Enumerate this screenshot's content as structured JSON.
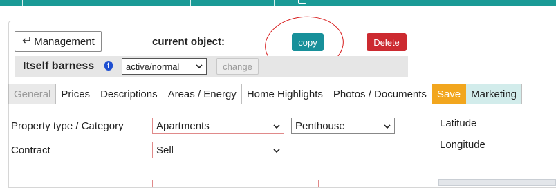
{
  "header": {
    "management_label": "Management",
    "current_object_label": "current object:",
    "copy_label": "copy",
    "delete_label": "Delete"
  },
  "status": {
    "title": "Itself barness",
    "selected": "active/normal",
    "change_label": "change"
  },
  "tabs": [
    {
      "label": "General"
    },
    {
      "label": "Prices"
    },
    {
      "label": "Descriptions"
    },
    {
      "label": "Areas / Energy"
    },
    {
      "label": "Home Highlights"
    },
    {
      "label": "Photos / Documents"
    },
    {
      "label": "Save"
    },
    {
      "label": "Marketing"
    }
  ],
  "form": {
    "property_type_label": "Property type / Category",
    "property_type_value": "Apartments",
    "category_value": "Penthouse",
    "contract_label": "Contract",
    "contract_value": "Sell",
    "latitude_label": "Latitude",
    "longitude_label": "Longitude"
  },
  "colors": {
    "accent": "#1a9a96",
    "copy": "#17909a",
    "delete": "#cc2a30",
    "save": "#f2a61e",
    "marketing_bg": "#d2eceb",
    "annotation": "#d81e1e"
  }
}
